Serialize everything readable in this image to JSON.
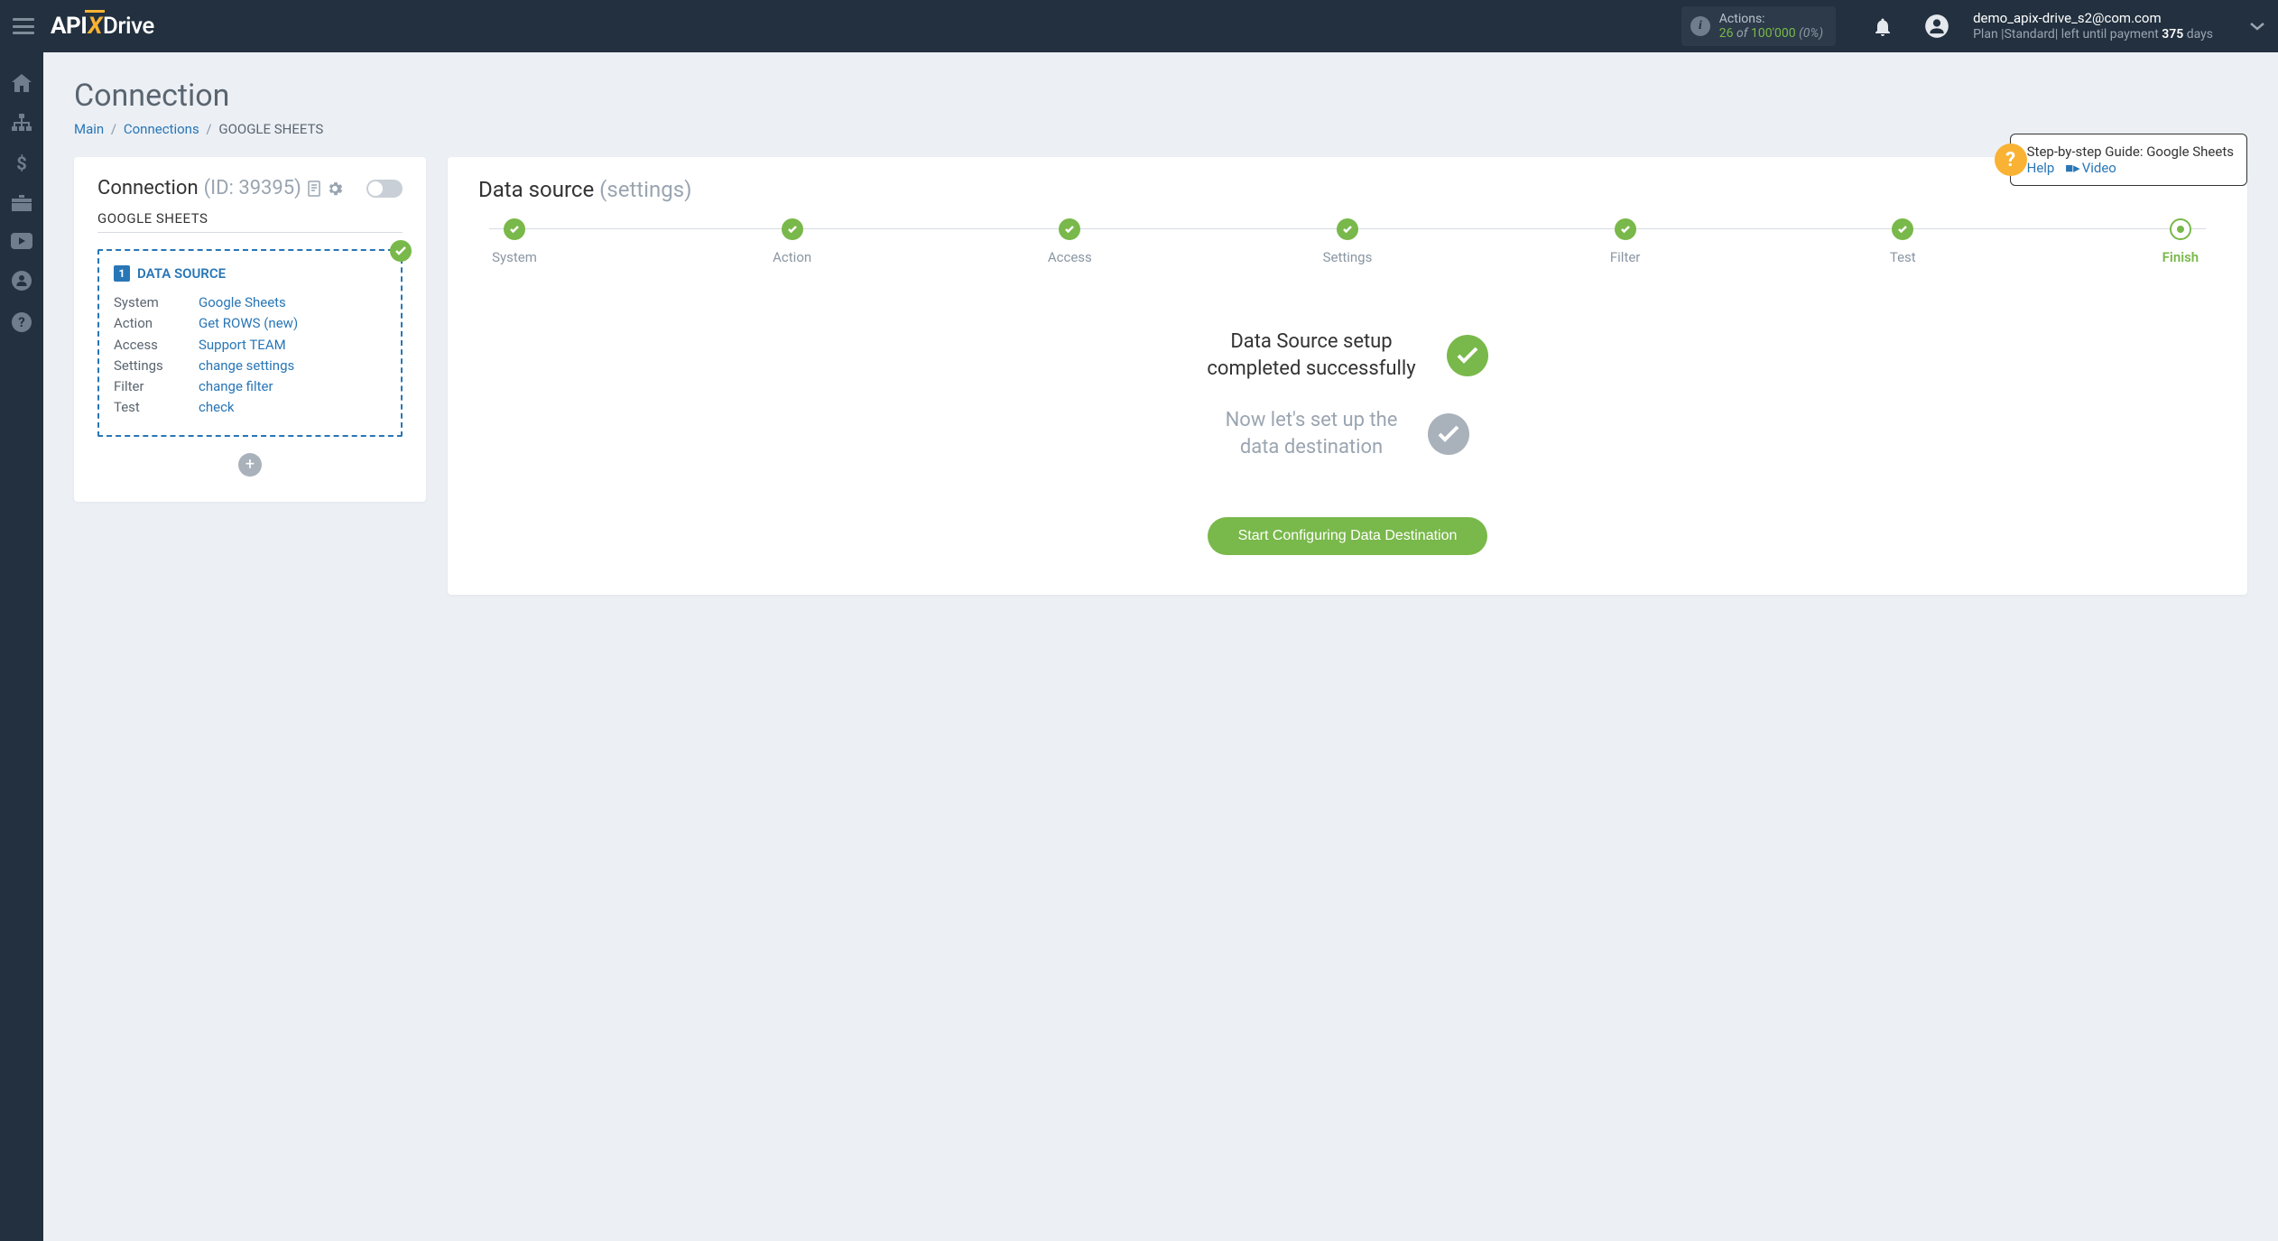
{
  "header": {
    "logo_parts": {
      "p1": "API",
      "p2": "X",
      "p3": "Drive"
    },
    "actions": {
      "label": "Actions:",
      "count": "26",
      "of": "of",
      "total": "100'000",
      "pct": "(0%)"
    },
    "user": {
      "email": "demo_apix-drive_s2@com.com",
      "plan_prefix": "Plan |Standard| left until payment ",
      "days": "375",
      "days_suffix": " days"
    }
  },
  "page": {
    "title": "Connection",
    "breadcrumb": {
      "main": "Main",
      "connections": "Connections",
      "current": "GOOGLE SHEETS"
    },
    "guide": {
      "title": "Step-by-step Guide: Google Sheets",
      "help": "Help",
      "video": "Video"
    }
  },
  "leftCard": {
    "title": "Connection",
    "id_label": "(ID: 39395)",
    "subtitle": "GOOGLE SHEETS",
    "ds": {
      "num": "1",
      "label": "DATA SOURCE",
      "rows": [
        {
          "lbl": "System",
          "val": "Google Sheets"
        },
        {
          "lbl": "Action",
          "val": "Get ROWS (new)"
        },
        {
          "lbl": "Access",
          "val": "Support TEAM"
        },
        {
          "lbl": "Settings",
          "val": "change settings"
        },
        {
          "lbl": "Filter",
          "val": "change filter"
        },
        {
          "lbl": "Test",
          "val": "check"
        }
      ]
    }
  },
  "rightCard": {
    "title": "Data source",
    "subtitle": "(settings)",
    "steps": [
      "System",
      "Action",
      "Access",
      "Settings",
      "Filter",
      "Test",
      "Finish"
    ],
    "success_line1": "Data Source setup",
    "success_line2": "completed successfully",
    "next_line1": "Now let's set up the",
    "next_line2": "data destination",
    "cta": "Start Configuring Data Destination"
  }
}
